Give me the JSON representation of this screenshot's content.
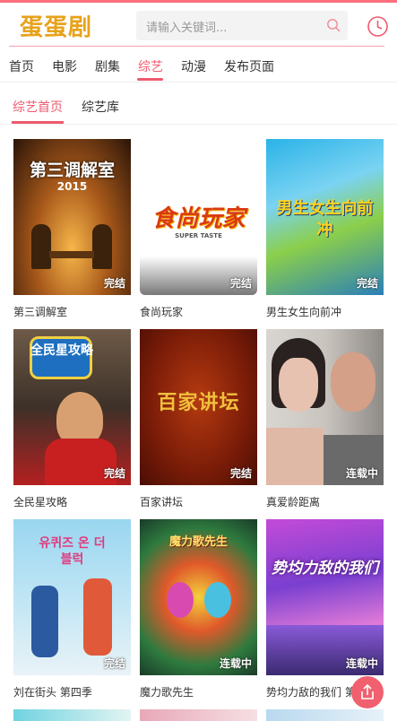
{
  "header": {
    "logo": "蛋蛋剧",
    "search_placeholder": "请输入关键词...",
    "icons": [
      "search-icon",
      "history-clock-icon"
    ]
  },
  "nav": {
    "items": [
      "首页",
      "电影",
      "剧集",
      "综艺",
      "动漫",
      "发布页面"
    ],
    "active": "综艺"
  },
  "subnav": {
    "items": [
      "综艺首页",
      "综艺库"
    ],
    "active": "综艺首页"
  },
  "shows": [
    {
      "title": "第三调解室",
      "badge": "完结",
      "poster_text": "第三调解室",
      "poster_sub": "2015"
    },
    {
      "title": "食尚玩家",
      "badge": "完结",
      "poster_text": "食尚玩家",
      "poster_sub": "SUPER TASTE"
    },
    {
      "title": "男生女生向前冲",
      "badge": "完结",
      "poster_text": "男生女生向前冲",
      "poster_sub": ""
    },
    {
      "title": "全民星攻略",
      "badge": "完结",
      "poster_text": "全民星攻略",
      "poster_sub": ""
    },
    {
      "title": "百家讲坛",
      "badge": "完结",
      "poster_text": "百家讲坛",
      "poster_sub": ""
    },
    {
      "title": "真爱龄距离",
      "badge": "连载中",
      "poster_text": "",
      "poster_sub": ""
    },
    {
      "title": "刘在街头 第四季",
      "badge": "完结",
      "poster_text": "유퀴즈 온 더 블럭",
      "poster_sub": ""
    },
    {
      "title": "魔力歌先生",
      "badge": "连载中",
      "poster_text": "魔力歌先生",
      "poster_sub": ""
    },
    {
      "title": "势均力敌的我们 第",
      "badge": "连载中",
      "poster_text": "势均力敌的我们",
      "poster_sub": ""
    }
  ],
  "colors": {
    "accent": "#ef5a6e",
    "logo": "#e8a21a"
  },
  "fab_icon": "share-upload-icon"
}
